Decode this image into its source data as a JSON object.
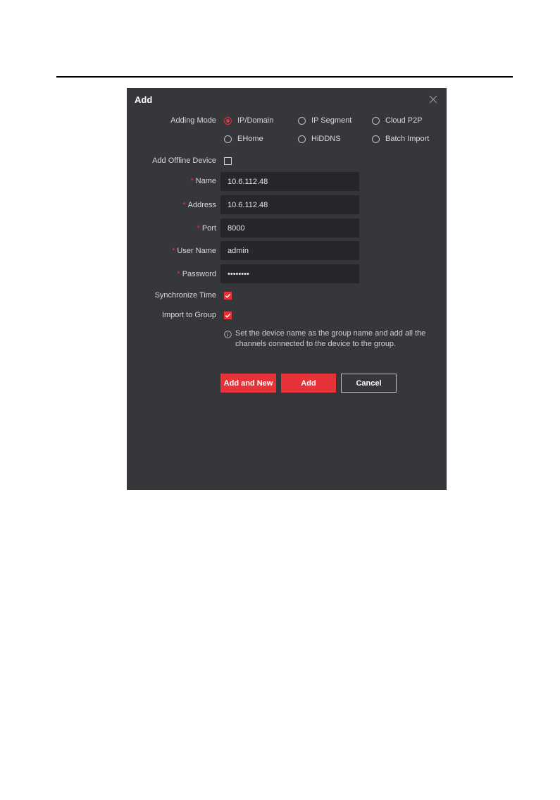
{
  "dialog": {
    "title": "Add",
    "adding_mode": {
      "label": "Adding Mode",
      "options": [
        "IP/Domain",
        "IP Segment",
        "Cloud P2P",
        "EHome",
        "HiDDNS",
        "Batch Import"
      ],
      "selected": "IP/Domain"
    },
    "add_offline_device": {
      "label": "Add Offline Device",
      "checked": false
    },
    "required_marker": "*",
    "fields": {
      "name": {
        "label": "Name",
        "value": "10.6.112.48"
      },
      "address": {
        "label": "Address",
        "value": "10.6.112.48"
      },
      "port": {
        "label": "Port",
        "value": "8000"
      },
      "user_name": {
        "label": "User Name",
        "value": "admin"
      },
      "password": {
        "label": "Password",
        "value": "••••••••"
      }
    },
    "synchronize_time": {
      "label": "Synchronize Time",
      "checked": true
    },
    "import_to_group": {
      "label": "Import to Group",
      "checked": true
    },
    "hint": "Set the device name as the group name and add all the channels connected to the device to the group.",
    "buttons": {
      "add_and_new": "Add and New",
      "add": "Add",
      "cancel": "Cancel"
    },
    "colors": {
      "accent": "#e8323a",
      "background": "#36373b",
      "field": "#26272b"
    }
  }
}
